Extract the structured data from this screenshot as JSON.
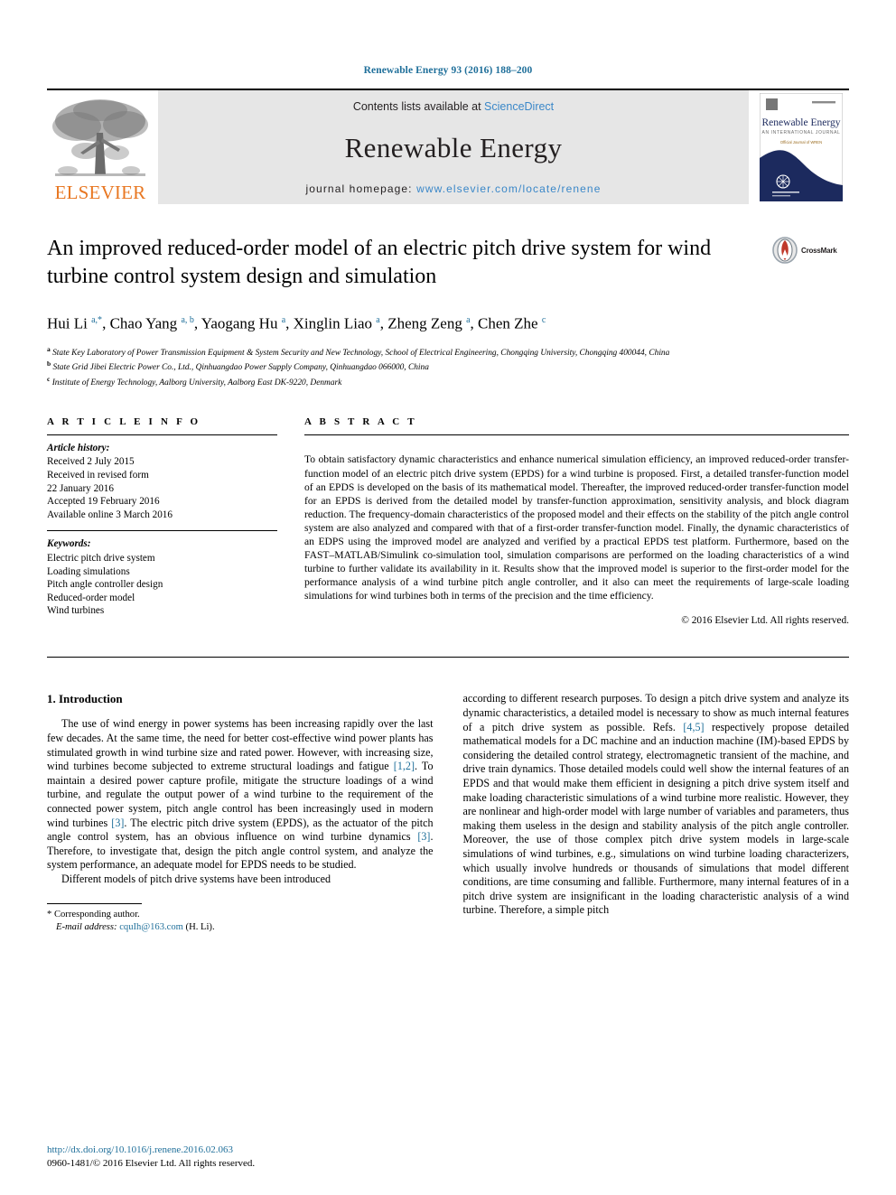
{
  "running_head": "Renewable Energy 93 (2016) 188–200",
  "masthead": {
    "publisher_name": "ELSEVIER",
    "contents_prefix": "Contents lists available at ",
    "contents_link": "ScienceDirect",
    "journal_name": "Renewable Energy",
    "homepage_prefix": "journal homepage: ",
    "homepage_link": "www.elsevier.com/locate/renene",
    "cover_title": "Renewable Energy",
    "cover_subtitle": "AN INTERNATIONAL JOURNAL",
    "cover_tagline": "Official Journal of WREN"
  },
  "article": {
    "title": "An improved reduced-order model of an electric pitch drive system for wind turbine control system design and simulation",
    "crossmark_label": "CrossMark",
    "authors": "Hui Li a,*, Chao Yang a,b, Yaogang Hu a, Xinglin Liao a, Zheng Zeng a, Chen Zhe c",
    "affiliations": [
      "a State Key Laboratory of Power Transmission Equipment & System Security and New Technology, School of Electrical Engineering, Chongqing University, Chongqing 400044, China",
      "b State Grid Jibei Electric Power Co., Ltd., Qinhuangdao Power Supply Company, Qinhuangdao 066000, China",
      "c Institute of Energy Technology, Aalborg University, Aalborg East DK-9220, Denmark"
    ]
  },
  "article_info": {
    "label": "A R T I C L E   I N F O",
    "history_heading": "Article history:",
    "history_items": [
      "Received 2 July 2015",
      "Received in revised form",
      "22 January 2016",
      "Accepted 19 February 2016",
      "Available online 3 March 2016"
    ],
    "keywords_heading": "Keywords:",
    "keywords": [
      "Electric pitch drive system",
      "Loading simulations",
      "Pitch angle controller design",
      "Reduced-order model",
      "Wind turbines"
    ]
  },
  "abstract": {
    "label": "A B S T R A C T",
    "text": "To obtain satisfactory dynamic characteristics and enhance numerical simulation efficiency, an improved reduced-order transfer-function model of an electric pitch drive system (EPDS) for a wind turbine is proposed. First, a detailed transfer-function model of an EPDS is developed on the basis of its mathematical model. Thereafter, the improved reduced-order transfer-function model for an EPDS is derived from the detailed model by transfer-function approximation, sensitivity analysis, and block diagram reduction. The frequency-domain characteristics of the proposed model and their effects on the stability of the pitch angle control system are also analyzed and compared with that of a first-order transfer-function model. Finally, the dynamic characteristics of an EDPS using the improved model are analyzed and verified by a practical EPDS test platform. Furthermore, based on the FAST–MATLAB/Simulink co-simulation tool, simulation comparisons are performed on the loading characteristics of a wind turbine to further validate its availability in it. Results show that the improved model is superior to the first-order model for the performance analysis of a wind turbine pitch angle controller, and it also can meet the requirements of large-scale loading simulations for wind turbines both in terms of the precision and the time efficiency.",
    "copyright": "© 2016 Elsevier Ltd. All rights reserved."
  },
  "body": {
    "section_title": "1. Introduction",
    "left_paragraphs": [
      "The use of wind energy in power systems has been increasing rapidly over the last few decades. At the same time, the need for better cost-effective wind power plants has stimulated growth in wind turbine size and rated power. However, with increasing size, wind turbines become subjected to extreme structural loadings and fatigue [1,2]. To maintain a desired power capture profile, mitigate the structure loadings of a wind turbine, and regulate the output power of a wind turbine to the requirement of the connected power system, pitch angle control has been increasingly used in modern wind turbines [3]. The electric pitch drive system (EPDS), as the actuator of the pitch angle control system, has an obvious influence on wind turbine dynamics [3]. Therefore, to investigate that, design the pitch angle control system, and analyze the system performance, an adequate model for EPDS needs to be studied.",
      "Different models of pitch drive systems have been introduced"
    ],
    "right_paragraphs": [
      "according to different research purposes. To design a pitch drive system and analyze its dynamic characteristics, a detailed model is necessary to show as much internal features of a pitch drive system as possible. Refs. [4,5] respectively propose detailed mathematical models for a DC machine and an induction machine (IM)-based EPDS by considering the detailed control strategy, electromagnetic transient of the machine, and drive train dynamics. Those detailed models could well show the internal features of an EPDS and that would make them efficient in designing a pitch drive system itself and make loading characteristic simulations of a wind turbine more realistic. However, they are nonlinear and high-order model with large number of variables and parameters, thus making them useless in the design and stability analysis of the pitch angle controller. Moreover, the use of those complex pitch drive system models in large-scale simulations of wind turbines, e.g., simulations on wind turbine loading characterizers, which usually involve hundreds or thousands of simulations that model different conditions, are time consuming and fallible. Furthermore, many internal features of in a pitch drive system are insignificant in the loading characteristic analysis of a wind turbine. Therefore, a simple pitch"
    ]
  },
  "footnote": {
    "corresponding": "* Corresponding author.",
    "email_prefix": "E-mail address: ",
    "email": "cquIh@163.com",
    "email_suffix": " (H. Li)."
  },
  "footer": {
    "doi": "http://dx.doi.org/10.1016/j.renene.2016.02.063",
    "issn_line": "0960-1481/© 2016 Elsevier Ltd. All rights reserved."
  },
  "colors": {
    "link_blue": "#1f6f9a",
    "sd_blue": "#3a87c8",
    "elsevier_orange": "#e87722",
    "masthead_gray": "#e6e6e6",
    "cover_navy": "#1c2a5e",
    "cover_gold": "#d4a017"
  }
}
